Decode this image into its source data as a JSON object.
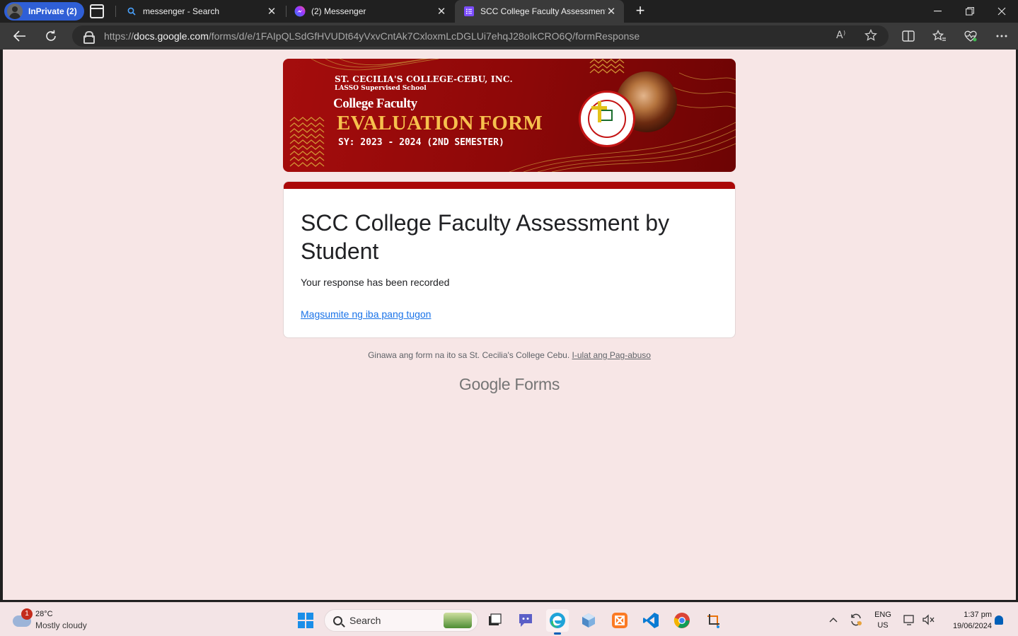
{
  "browser": {
    "profile_label": "InPrivate (2)",
    "tabs": [
      {
        "title": "messenger - Search",
        "icon": "search-icon"
      },
      {
        "title": "(2) Messenger",
        "icon": "messenger-icon"
      },
      {
        "title": "SCC College Faculty Assessment b",
        "icon": "google-forms-icon",
        "active": true
      }
    ],
    "url_prefix": "https://",
    "url_host": "docs.google.com",
    "url_path": "/forms/d/e/1FAIpQLSdGfHVUDt64yVxvCntAk7CxloxmLcDGLUi7ehqJ28oIkCRO6Q/formResponse"
  },
  "banner": {
    "school": "ST. CECILIA'S COLLEGE-CEBU, INC.",
    "supervised": "LASSO Supervised School",
    "subtitle": "College Faculty",
    "title": "EVALUATION FORM",
    "sy": "SY: 2023 - 2024 (2ND SEMESTER)",
    "accent_color": "#f6c04d",
    "background_color": "#9c0b0b"
  },
  "form": {
    "title": "SCC College Faculty Assessment by Student",
    "message": "Your response has been recorded",
    "link": "Magsumite ng iba pang tugon",
    "theme_color": "#ab0808"
  },
  "footer": {
    "note": "Ginawa ang form na ito sa St. Cecilia's College Cebu.",
    "abuse_link": "I-ulat ang Pag-abuso",
    "brand_google": "Google",
    "brand_forms": "Forms"
  },
  "taskbar": {
    "weather_badge": "1",
    "temperature": "28°C",
    "condition": "Mostly cloudy",
    "search_placeholder": "Search",
    "lang_1": "ENG",
    "lang_2": "US",
    "time": "1:37 pm",
    "date": "19/06/2024"
  }
}
